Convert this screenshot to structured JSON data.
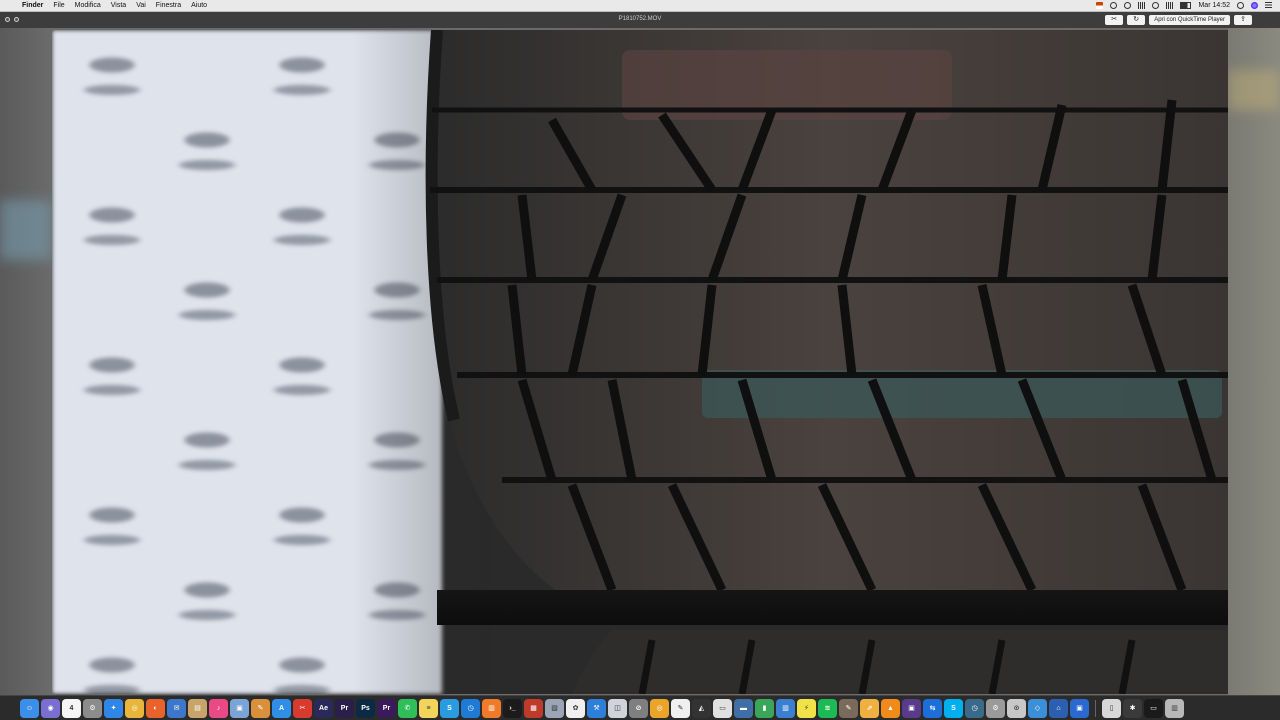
{
  "menu_bar": {
    "app_name": "Finder",
    "items": [
      "File",
      "Modifica",
      "Vista",
      "Vai",
      "Finestra",
      "Aiuto"
    ],
    "clock": "Mar 14:52"
  },
  "window": {
    "title": "P1810752.MOV",
    "open_button_label": "Apri con QuickTime Player"
  },
  "dock": {
    "apps": [
      {
        "name": "finder-icon",
        "color": "#3b8fe8",
        "glyph": "☺"
      },
      {
        "name": "launchpad-icon",
        "color": "#7a6fd0",
        "glyph": "◉"
      },
      {
        "name": "calendar-icon",
        "color": "#f5f5f5",
        "glyph": "4"
      },
      {
        "name": "automator-icon",
        "color": "#8c8c8c",
        "glyph": "⚙"
      },
      {
        "name": "safari-icon",
        "color": "#2f86e6",
        "glyph": "✦"
      },
      {
        "name": "chrome-icon",
        "color": "#e9b53a",
        "glyph": "◎"
      },
      {
        "name": "firefox-icon",
        "color": "#e8622c",
        "glyph": "◐"
      },
      {
        "name": "mail-icon",
        "color": "#3c77c9",
        "glyph": "✉"
      },
      {
        "name": "books-icon",
        "color": "#c8a46a",
        "glyph": "▤"
      },
      {
        "name": "itunes-icon",
        "color": "#e94a86",
        "glyph": "♪"
      },
      {
        "name": "preview-icon",
        "color": "#7ca3d6",
        "glyph": "▣"
      },
      {
        "name": "pencil-icon",
        "color": "#d9903a",
        "glyph": "✎"
      },
      {
        "name": "app-store-icon",
        "color": "#2f8fe8",
        "glyph": "A"
      },
      {
        "name": "acrobat-icon",
        "color": "#d93a2e",
        "glyph": "✂"
      },
      {
        "name": "after-effects-icon",
        "color": "#2a2a5a",
        "glyph": "Ae"
      },
      {
        "name": "premiere-icon",
        "color": "#2a1f4a",
        "glyph": "Pr"
      },
      {
        "name": "photoshop-icon",
        "color": "#0d2a45",
        "glyph": "Ps"
      },
      {
        "name": "premiere-pro-icon",
        "color": "#3a1a5a",
        "glyph": "Pr"
      },
      {
        "name": "whatsapp-icon",
        "color": "#2fbf5a",
        "glyph": "✆"
      },
      {
        "name": "notes-icon",
        "color": "#f2d45a",
        "glyph": "≡"
      },
      {
        "name": "skype-icon",
        "color": "#2b9be0",
        "glyph": "S"
      },
      {
        "name": "vlc-alt-icon",
        "color": "#1f7ad6",
        "glyph": "◷"
      },
      {
        "name": "ibooks-icon",
        "color": "#f07a2a",
        "glyph": "▥"
      },
      {
        "name": "terminal-icon",
        "color": "#1b1b1b",
        "glyph": "›_"
      },
      {
        "name": "photo-booth-icon",
        "color": "#c03a2a",
        "glyph": "▦"
      },
      {
        "name": "image-capture-icon",
        "color": "#9aa6b5",
        "glyph": "▧"
      },
      {
        "name": "photos-icon",
        "color": "#f0f0f0",
        "glyph": "✿"
      },
      {
        "name": "xcode-icon",
        "color": "#2e7fd9",
        "glyph": "⚒"
      },
      {
        "name": "finder-2-icon",
        "color": "#d0d4da",
        "glyph": "◫"
      },
      {
        "name": "compass-icon",
        "color": "#7f7f7f",
        "glyph": "⊘"
      },
      {
        "name": "chrome-2-icon",
        "color": "#eaa42a",
        "glyph": "◎"
      },
      {
        "name": "textedit-icon",
        "color": "#f0f0f0",
        "glyph": "✎"
      },
      {
        "name": "final-cut-icon",
        "color": "#333333",
        "glyph": "◭"
      },
      {
        "name": "clapper-icon",
        "color": "#e0e0e0",
        "glyph": "▭"
      },
      {
        "name": "video-icon",
        "color": "#3f6fa6",
        "glyph": "▬"
      },
      {
        "name": "numbers-icon",
        "color": "#3aa65a",
        "glyph": "▮"
      },
      {
        "name": "keynote-icon",
        "color": "#3b7fd0",
        "glyph": "▥"
      },
      {
        "name": "stickies-icon",
        "color": "#f2e24a",
        "glyph": "⚡"
      },
      {
        "name": "spotify-icon",
        "color": "#1db954",
        "glyph": "≋"
      },
      {
        "name": "steam-icon",
        "color": "#7a6a5a",
        "glyph": "✎"
      },
      {
        "name": "launch-icon",
        "color": "#f0b040",
        "glyph": "⇗"
      },
      {
        "name": "vlc-icon",
        "color": "#f08a1a",
        "glyph": "▲"
      },
      {
        "name": "utility-icon",
        "color": "#5a3a8a",
        "glyph": "▣"
      },
      {
        "name": "teamviewer-icon",
        "color": "#1c6fd9",
        "glyph": "⇆"
      },
      {
        "name": "skype-2-icon",
        "color": "#00aff0",
        "glyph": "S"
      },
      {
        "name": "time-machine-icon",
        "color": "#3a6a8a",
        "glyph": "◷"
      },
      {
        "name": "system-preferences-icon",
        "color": "#9a9a9a",
        "glyph": "⚙"
      },
      {
        "name": "disk-utility-icon",
        "color": "#c8c8c8",
        "glyph": "⊙"
      },
      {
        "name": "migration-icon",
        "color": "#3a8fd8",
        "glyph": "◇"
      },
      {
        "name": "directory-icon",
        "color": "#2d5fb0",
        "glyph": "⌂"
      },
      {
        "name": "screen-sharing-icon",
        "color": "#2a6ad0",
        "glyph": "▣"
      }
    ],
    "extras": [
      {
        "name": "document-icon",
        "color": "#d8d8d8",
        "glyph": "▯"
      },
      {
        "name": "bluetooth-icon",
        "color": "#3a3a3a",
        "glyph": "✱"
      },
      {
        "name": "monitor-icon",
        "color": "#1a1a1a",
        "glyph": "▭"
      },
      {
        "name": "trash-icon",
        "color": "#b8b8b8",
        "glyph": "▥"
      }
    ]
  }
}
